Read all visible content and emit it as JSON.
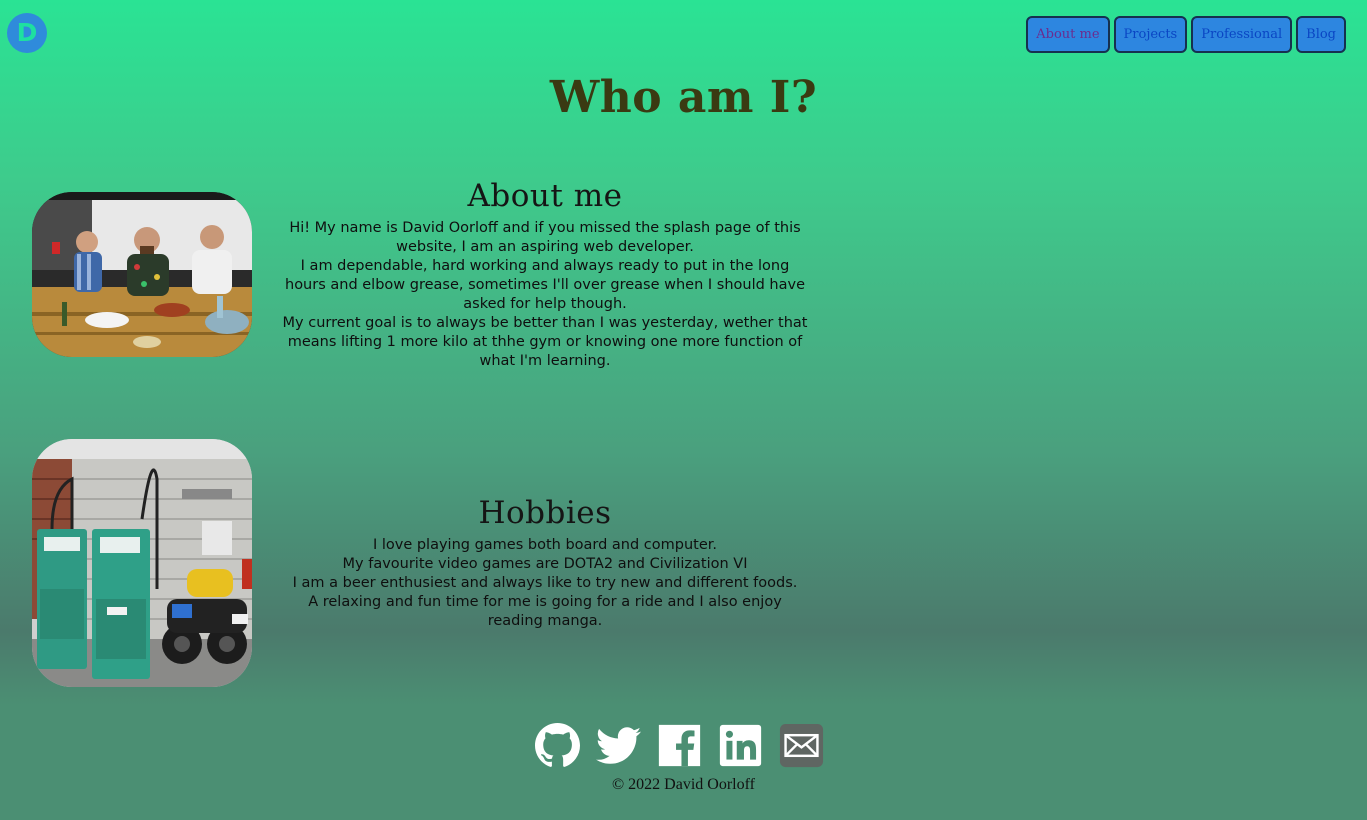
{
  "logo": {
    "letter": "D"
  },
  "nav": {
    "items": [
      {
        "label": "About me"
      },
      {
        "label": "Projects"
      },
      {
        "label": "Professional"
      },
      {
        "label": "Blog"
      }
    ]
  },
  "page": {
    "title": "Who am I?"
  },
  "about": {
    "heading": "About me",
    "paragraphs": [
      "Hi! My name is David Oorloff and if you missed the splash page of this website, I am an aspiring web developer.",
      "I am dependable, hard working and always ready to put in the long hours and elbow grease, sometimes I'll over grease when I should have asked for help though.",
      "My current goal is to always be better than I was yesterday, wether that means lifting 1 more kilo at thhe gym or knowing one more function of what I'm learning."
    ]
  },
  "hobbies": {
    "heading": "Hobbies",
    "paragraphs": [
      "I love playing games both board and computer.",
      "My favourite video games are DOTA2 and Civilization VI",
      "I am a beer enthusiest and always like to try new and different foods.",
      "A relaxing and fun time for me is going for a ride and I also enjoy reading manga."
    ]
  },
  "social": {
    "icons": [
      "github-icon",
      "twitter-icon",
      "facebook-icon",
      "linkedin-icon",
      "email-icon"
    ]
  },
  "footer": {
    "copyright": "© 2022 David Oorloff"
  },
  "colors": {
    "gradient_top": "#2ae394",
    "gradient_bottom": "#4b7a6c",
    "nav_button_bg": "#2d86e0",
    "logo_bg": "#2f8bdb",
    "title": "#3a3a12"
  }
}
